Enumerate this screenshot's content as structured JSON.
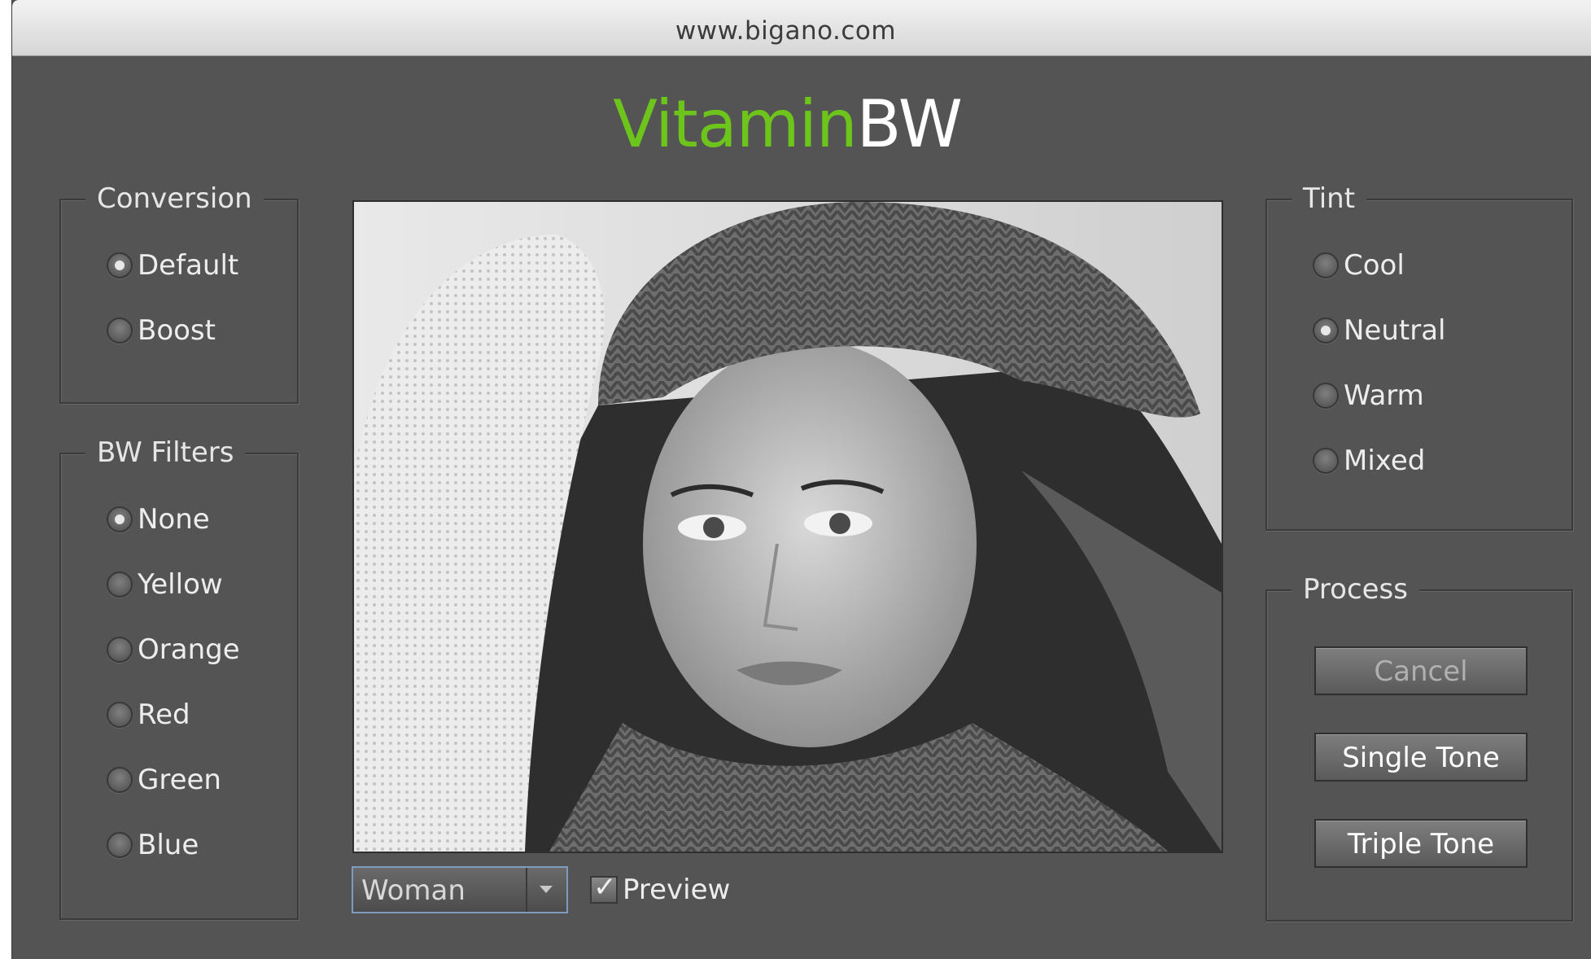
{
  "window": {
    "title": "www.bigano.com"
  },
  "app": {
    "title_part1": "Vitamin",
    "title_part2": "BW",
    "accent_color": "#6dc51c"
  },
  "conversion": {
    "label": "Conversion",
    "options": [
      {
        "label": "Default",
        "selected": true
      },
      {
        "label": "Boost",
        "selected": false
      }
    ]
  },
  "bw_filters": {
    "label": "BW Filters",
    "options": [
      {
        "label": "None",
        "selected": true
      },
      {
        "label": "Yellow",
        "selected": false
      },
      {
        "label": "Orange",
        "selected": false
      },
      {
        "label": "Red",
        "selected": false
      },
      {
        "label": "Green",
        "selected": false
      },
      {
        "label": "Blue",
        "selected": false
      }
    ]
  },
  "tint": {
    "label": "Tint",
    "options": [
      {
        "label": "Cool",
        "selected": false
      },
      {
        "label": "Neutral",
        "selected": true
      },
      {
        "label": "Warm",
        "selected": false
      },
      {
        "label": "Mixed",
        "selected": false
      }
    ]
  },
  "process": {
    "label": "Process",
    "buttons": [
      {
        "label": "Cancel",
        "enabled": false
      },
      {
        "label": "Single Tone",
        "enabled": true
      },
      {
        "label": "Triple Tone",
        "enabled": true
      }
    ]
  },
  "preview": {
    "sample_selected": "Woman",
    "checkbox_label": "Preview",
    "checked": true
  }
}
